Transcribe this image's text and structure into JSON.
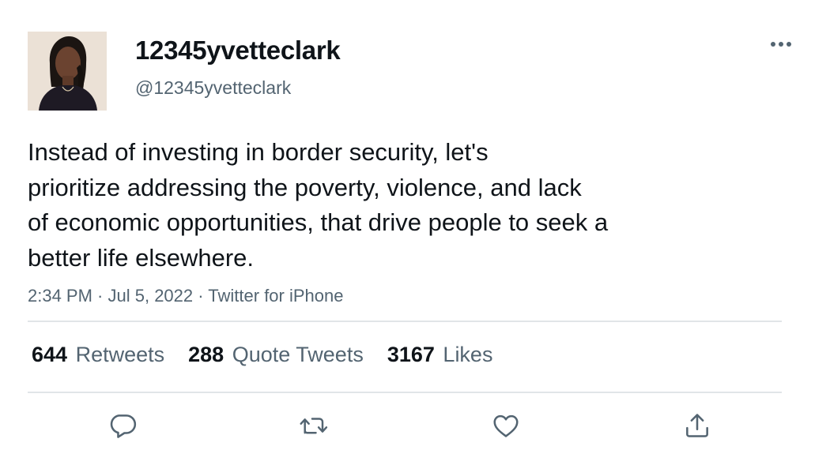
{
  "user": {
    "display_name": "12345yvetteclark",
    "handle": "@12345yvetteclark"
  },
  "tweet": {
    "text": "Instead of investing in border security, let's\nprioritize addressing the poverty, violence, and lack\nof economic opportunities, that drive people to seek a\nbetter life elsewhere.",
    "time": "2:34 PM",
    "date": "Jul 5, 2022",
    "source": "Twitter for iPhone",
    "separator": " · "
  },
  "stats": {
    "retweets": {
      "count": "644",
      "label": "Retweets"
    },
    "quotes": {
      "count": "288",
      "label": "Quote Tweets"
    },
    "likes": {
      "count": "3167",
      "label": "Likes"
    }
  },
  "icons": {
    "more": "more-horizontal-icon",
    "reply": "reply-icon",
    "retweet": "retweet-icon",
    "like": "heart-icon",
    "share": "share-icon"
  },
  "colors": {
    "text_primary": "#0f1419",
    "text_secondary": "#536471",
    "icon": "#536471",
    "divider": "#e1e5e8"
  }
}
